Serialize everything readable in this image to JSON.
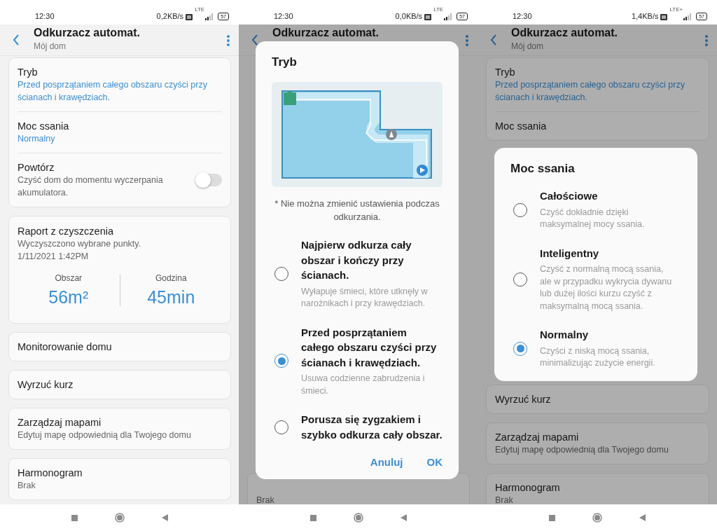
{
  "phones": [
    {
      "status": {
        "time": "12:30",
        "speed": "0,2KB/s",
        "network": "LTE",
        "battery": "57"
      },
      "appbar": {
        "title": "Odkurzacz automat.",
        "subtitle": "Mój dom"
      },
      "top_cards": [
        {
          "kind": "settings",
          "rows": [
            {
              "kind": "value",
              "title": "Tryb",
              "value": "Przed posprzątaniem całego obszaru czyści przy ścianach i krawędziach."
            },
            {
              "kind": "value",
              "title": "Moc ssania",
              "value": "Normalny"
            },
            {
              "kind": "toggle",
              "title": "Powtórz",
              "desc": "Czyść dom do momentu wyczerpania akumulatora.",
              "on": false
            }
          ]
        },
        {
          "kind": "report",
          "title": "Raport z czyszczenia",
          "lines": [
            "Wyczyszczono wybrane punkty.",
            "1/11/2021 1:42PM"
          ],
          "stats": [
            {
              "label": "Obszar",
              "value": "56m²"
            },
            {
              "label": "Godzina",
              "value": "45min"
            }
          ]
        },
        {
          "kind": "link",
          "title": "Monitorowanie domu"
        },
        {
          "kind": "link",
          "title": "Wyrzuć kurz"
        },
        {
          "kind": "link",
          "title": "Zarządzaj mapami",
          "desc": "Edytuj mapę odpowiednią dla Twojego domu"
        },
        {
          "kind": "link",
          "title": "Harmonogram",
          "desc": "Brak"
        }
      ]
    },
    {
      "status": {
        "time": "12:30",
        "speed": "0,0KB/s",
        "network": "LTE",
        "battery": "57"
      },
      "appbar": {
        "title": "Odkurzacz automat."
      },
      "bottom_cards": [
        {
          "kind": "link",
          "desc": "Brak"
        }
      ],
      "dialog": {
        "title": "Tryb",
        "illustration": {
          "kind": "map"
        },
        "note": "* Nie można zmienić ustawienia podczas odkurzania.",
        "options": [
          {
            "title": "Najpierw odkurza cały obszar i kończy przy ścianach.",
            "desc": "Wyłapuje śmieci, które utknęły w narożnikach i przy krawędziach.",
            "selected": false
          },
          {
            "title": "Przed posprzątaniem całego obszaru czyści przy ścianach i krawędziach.",
            "desc": "Usuwa codzienne zabrudzenia i śmieci.",
            "selected": true
          },
          {
            "title": "Porusza się zygzakiem i szybko odkurza cały obszar.",
            "selected": false
          }
        ],
        "buttons": [
          "Anuluj",
          "OK"
        ]
      }
    },
    {
      "status": {
        "time": "12:30",
        "speed": "1,4KB/s",
        "network": "LTE+",
        "battery": "57"
      },
      "appbar": {
        "title": "Odkurzacz automat.",
        "subtitle": "Mój dom"
      },
      "top_cards": [
        {
          "kind": "settings",
          "rows": [
            {
              "kind": "value",
              "title": "Tryb",
              "value": "Przed posprzątaniem całego obszaru czyści przy ścianach i krawędziach."
            },
            {
              "kind": "value",
              "title": "Moc ssania"
            }
          ]
        }
      ],
      "bottom_cards": [
        {
          "kind": "link",
          "title": "Wyrzuć kurz"
        },
        {
          "kind": "link",
          "title": "Zarządzaj mapami",
          "desc": "Edytuj mapę odpowiednią dla Twojego domu"
        },
        {
          "kind": "link",
          "title": "Harmonogram",
          "desc": "Brak"
        }
      ],
      "dialog": {
        "title": "Moc ssania",
        "options": [
          {
            "title": "Całościowe",
            "desc": "Czyść dokładnie dzięki maksymalnej mocy ssania.",
            "selected": false
          },
          {
            "title": "Inteligentny",
            "desc": "Czyść z normalną mocą ssania, ale w przypadku wykrycia dywanu lub dużej ilości kurzu czyść z maksymalną mocą ssania.",
            "selected": false
          },
          {
            "title": "Normalny",
            "desc": "Czyści z niską mocą ssania, minimalizując zużycie energii.",
            "selected": true
          }
        ]
      }
    }
  ]
}
